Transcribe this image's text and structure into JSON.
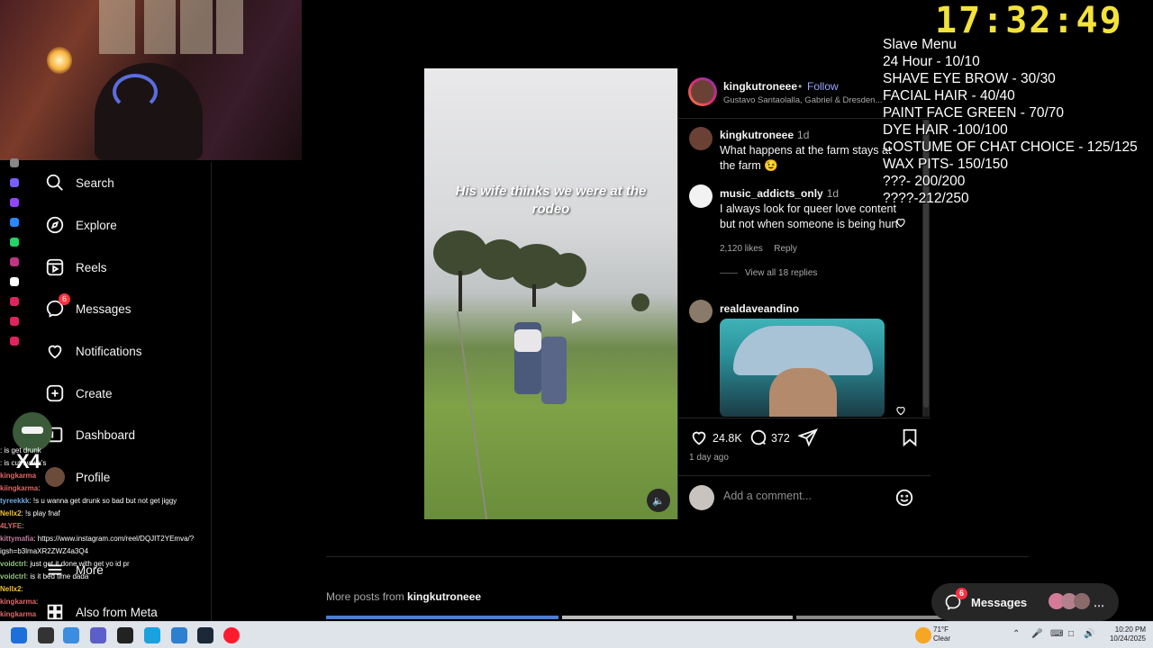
{
  "overlay": {
    "clock": "17:32:49",
    "slave_menu": {
      "title": "Slave Menu",
      "items": [
        "24 Hour - 10/10",
        "SHAVE EYE BROW - 30/30",
        "FACIAL HAIR - 40/40",
        "PAINT FACE GREEN - 70/70",
        "DYE HAIR -100/100",
        "COSTUME OF CHAT CHOICE - 125/125",
        "WAX PITS- 150/150",
        "???- 200/200",
        "????-212/250"
      ]
    },
    "chat_multiplier": "X4",
    "chat": [
      {
        "user": "",
        "msg": ": is get drunk",
        "color": "#e06666"
      },
      {
        "user": "",
        "msg": ": is cut wawa's",
        "color": "#e06666"
      },
      {
        "user": "kingkarma",
        "msg": "",
        "color": "#e06666"
      },
      {
        "user": "kiingkarma",
        "msg": ":",
        "color": "#e06666"
      },
      {
        "user": "tyreekkk",
        "msg": ": !s u wanna get drunk so bad but not get jiggy",
        "color": "#6fa8dc"
      },
      {
        "user": "Nellx2",
        "msg": ": !s play fnaf",
        "color": "#f1c232"
      },
      {
        "user": "4LYFE",
        "msg": ":",
        "color": "#e06666"
      },
      {
        "user": "kittymafia",
        "msg": ": https://www.instagram.com/reel/DQJIT2YEmva/?",
        "color": "#c27ba0"
      },
      {
        "user": "",
        "msg": "igsh=b3lmaXR2ZWZ4a3Q4",
        "color": "#ffffff"
      },
      {
        "user": "voidctrl",
        "msg": ": just get it done with get yo id pr",
        "color": "#93c47d"
      },
      {
        "user": "voidctrl",
        "msg": ": is it bed time dada",
        "color": "#93c47d"
      },
      {
        "user": "Nellx2",
        "msg": ":",
        "color": "#f1c232"
      },
      {
        "user": "kingkarma",
        "msg": ":",
        "color": "#e06666"
      },
      {
        "user": "kingkarma",
        "msg": "",
        "color": "#e06666"
      }
    ]
  },
  "sidebar": {
    "items": [
      {
        "label": "Search",
        "icon": "search-icon"
      },
      {
        "label": "Explore",
        "icon": "compass-icon"
      },
      {
        "label": "Reels",
        "icon": "reels-icon"
      },
      {
        "label": "Messages",
        "icon": "messenger-icon",
        "badge": "6"
      },
      {
        "label": "Notifications",
        "icon": "heart-icon"
      },
      {
        "label": "Create",
        "icon": "plus-square-icon"
      },
      {
        "label": "Dashboard",
        "icon": "dashboard-icon"
      },
      {
        "label": "Profile",
        "icon": "avatar"
      },
      {
        "label": "More",
        "icon": "menu-icon"
      },
      {
        "label": "Also from Meta",
        "icon": "meta-icon"
      }
    ]
  },
  "post": {
    "media": {
      "caption_overlay": "His wife thinks we were at the rodeo"
    },
    "header": {
      "username": "kingkutroneee",
      "separator": "•",
      "follow": "Follow",
      "audio": "Gustavo Santaolalla, Gabriel & Dresden..."
    },
    "comments": [
      {
        "user": "kingkutroneee",
        "time": "1d",
        "text": "What happens at the farm stays at the farm 😉"
      },
      {
        "user": "music_addicts_only",
        "time": "1d",
        "text": "I always look for queer love content but not when someone is being hurt",
        "likes": "2,120 likes",
        "reply": "Reply",
        "view_replies": "View all 18 replies"
      },
      {
        "user": "realdaveandino",
        "time": "",
        "text": ""
      }
    ],
    "actions": {
      "likes": "24.8K",
      "comments": "372",
      "posted": "1 day ago"
    },
    "comment_placeholder": "Add a comment..."
  },
  "more_posts": {
    "prefix": "More posts from",
    "username": "kingkutroneee"
  },
  "messages_pill": {
    "label": "Messages",
    "badge": "6"
  },
  "taskbar": {
    "weather_temp": "71°F",
    "weather_desc": "Clear",
    "time": "10:20 PM",
    "date": "10/24/2025"
  },
  "colors": {
    "accent_follow": "#9aa7ff",
    "badge": "#ff3040",
    "clock": "#f3e23a"
  }
}
